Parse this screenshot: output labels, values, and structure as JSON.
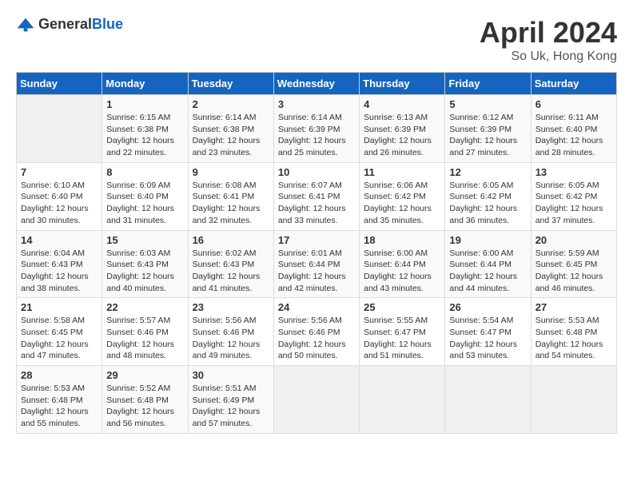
{
  "header": {
    "logo_general": "General",
    "logo_blue": "Blue",
    "month": "April 2024",
    "location": "So Uk, Hong Kong"
  },
  "weekdays": [
    "Sunday",
    "Monday",
    "Tuesday",
    "Wednesday",
    "Thursday",
    "Friday",
    "Saturday"
  ],
  "weeks": [
    [
      {
        "day": "",
        "empty": true
      },
      {
        "day": "1",
        "sunrise": "6:15 AM",
        "sunset": "6:38 PM",
        "daylight": "12 hours and 22 minutes."
      },
      {
        "day": "2",
        "sunrise": "6:14 AM",
        "sunset": "6:38 PM",
        "daylight": "12 hours and 23 minutes."
      },
      {
        "day": "3",
        "sunrise": "6:14 AM",
        "sunset": "6:39 PM",
        "daylight": "12 hours and 25 minutes."
      },
      {
        "day": "4",
        "sunrise": "6:13 AM",
        "sunset": "6:39 PM",
        "daylight": "12 hours and 26 minutes."
      },
      {
        "day": "5",
        "sunrise": "6:12 AM",
        "sunset": "6:39 PM",
        "daylight": "12 hours and 27 minutes."
      },
      {
        "day": "6",
        "sunrise": "6:11 AM",
        "sunset": "6:40 PM",
        "daylight": "12 hours and 28 minutes."
      }
    ],
    [
      {
        "day": "7",
        "sunrise": "6:10 AM",
        "sunset": "6:40 PM",
        "daylight": "12 hours and 30 minutes."
      },
      {
        "day": "8",
        "sunrise": "6:09 AM",
        "sunset": "6:40 PM",
        "daylight": "12 hours and 31 minutes."
      },
      {
        "day": "9",
        "sunrise": "6:08 AM",
        "sunset": "6:41 PM",
        "daylight": "12 hours and 32 minutes."
      },
      {
        "day": "10",
        "sunrise": "6:07 AM",
        "sunset": "6:41 PM",
        "daylight": "12 hours and 33 minutes."
      },
      {
        "day": "11",
        "sunrise": "6:06 AM",
        "sunset": "6:42 PM",
        "daylight": "12 hours and 35 minutes."
      },
      {
        "day": "12",
        "sunrise": "6:05 AM",
        "sunset": "6:42 PM",
        "daylight": "12 hours and 36 minutes."
      },
      {
        "day": "13",
        "sunrise": "6:05 AM",
        "sunset": "6:42 PM",
        "daylight": "12 hours and 37 minutes."
      }
    ],
    [
      {
        "day": "14",
        "sunrise": "6:04 AM",
        "sunset": "6:43 PM",
        "daylight": "12 hours and 38 minutes."
      },
      {
        "day": "15",
        "sunrise": "6:03 AM",
        "sunset": "6:43 PM",
        "daylight": "12 hours and 40 minutes."
      },
      {
        "day": "16",
        "sunrise": "6:02 AM",
        "sunset": "6:43 PM",
        "daylight": "12 hours and 41 minutes."
      },
      {
        "day": "17",
        "sunrise": "6:01 AM",
        "sunset": "6:44 PM",
        "daylight": "12 hours and 42 minutes."
      },
      {
        "day": "18",
        "sunrise": "6:00 AM",
        "sunset": "6:44 PM",
        "daylight": "12 hours and 43 minutes."
      },
      {
        "day": "19",
        "sunrise": "6:00 AM",
        "sunset": "6:44 PM",
        "daylight": "12 hours and 44 minutes."
      },
      {
        "day": "20",
        "sunrise": "5:59 AM",
        "sunset": "6:45 PM",
        "daylight": "12 hours and 46 minutes."
      }
    ],
    [
      {
        "day": "21",
        "sunrise": "5:58 AM",
        "sunset": "6:45 PM",
        "daylight": "12 hours and 47 minutes."
      },
      {
        "day": "22",
        "sunrise": "5:57 AM",
        "sunset": "6:46 PM",
        "daylight": "12 hours and 48 minutes."
      },
      {
        "day": "23",
        "sunrise": "5:56 AM",
        "sunset": "6:46 PM",
        "daylight": "12 hours and 49 minutes."
      },
      {
        "day": "24",
        "sunrise": "5:56 AM",
        "sunset": "6:46 PM",
        "daylight": "12 hours and 50 minutes."
      },
      {
        "day": "25",
        "sunrise": "5:55 AM",
        "sunset": "6:47 PM",
        "daylight": "12 hours and 51 minutes."
      },
      {
        "day": "26",
        "sunrise": "5:54 AM",
        "sunset": "6:47 PM",
        "daylight": "12 hours and 53 minutes."
      },
      {
        "day": "27",
        "sunrise": "5:53 AM",
        "sunset": "6:48 PM",
        "daylight": "12 hours and 54 minutes."
      }
    ],
    [
      {
        "day": "28",
        "sunrise": "5:53 AM",
        "sunset": "6:48 PM",
        "daylight": "12 hours and 55 minutes."
      },
      {
        "day": "29",
        "sunrise": "5:52 AM",
        "sunset": "6:48 PM",
        "daylight": "12 hours and 56 minutes."
      },
      {
        "day": "30",
        "sunrise": "5:51 AM",
        "sunset": "6:49 PM",
        "daylight": "12 hours and 57 minutes."
      },
      {
        "day": "",
        "empty": true
      },
      {
        "day": "",
        "empty": true
      },
      {
        "day": "",
        "empty": true
      },
      {
        "day": "",
        "empty": true
      }
    ]
  ],
  "labels": {
    "sunrise": "Sunrise:",
    "sunset": "Sunset:",
    "daylight": "Daylight:"
  }
}
